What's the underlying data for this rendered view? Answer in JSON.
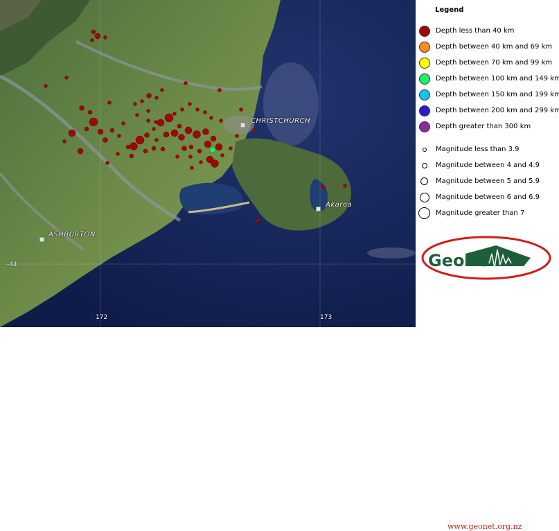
{
  "map": {
    "places": [
      {
        "name": "CHRISTCHURCH"
      },
      {
        "name": "ASHBURTON"
      },
      {
        "name": "Akaroa"
      }
    ],
    "grid": {
      "longitudes": [
        "172",
        "173"
      ],
      "latitudes": [
        "-44"
      ]
    }
  },
  "legend": {
    "title": "Legend",
    "depth": [
      {
        "label": "Depth less than 40 km",
        "color": "#9b0a0a"
      },
      {
        "label": "Depth between 40 km and 69 km",
        "color": "#ff8c1a"
      },
      {
        "label": "Depth between 70 km and 99 km",
        "color": "#ffff00"
      },
      {
        "label": "Depth between 100 km and 149 km",
        "color": "#22ee66"
      },
      {
        "label": "Depth between 150 km and 199 km",
        "color": "#11c4ee"
      },
      {
        "label": "Depth between 200 km and 299 km",
        "color": "#2a1ac8"
      },
      {
        "label": "Depth greater than 300 km",
        "color": "#8e2a9e"
      }
    ],
    "magnitude": [
      {
        "label": "Magnitude less than 3.9"
      },
      {
        "label": "Magnitude between 4 and 4.9"
      },
      {
        "label": "Magnitude between 5 and 5.9"
      },
      {
        "label": "Magnitude between 6 and 6.9"
      },
      {
        "label": "Magnitude greater than 7"
      }
    ]
  },
  "logo": {
    "text": "GeoNet",
    "url": "www.geonet.org.nz"
  }
}
